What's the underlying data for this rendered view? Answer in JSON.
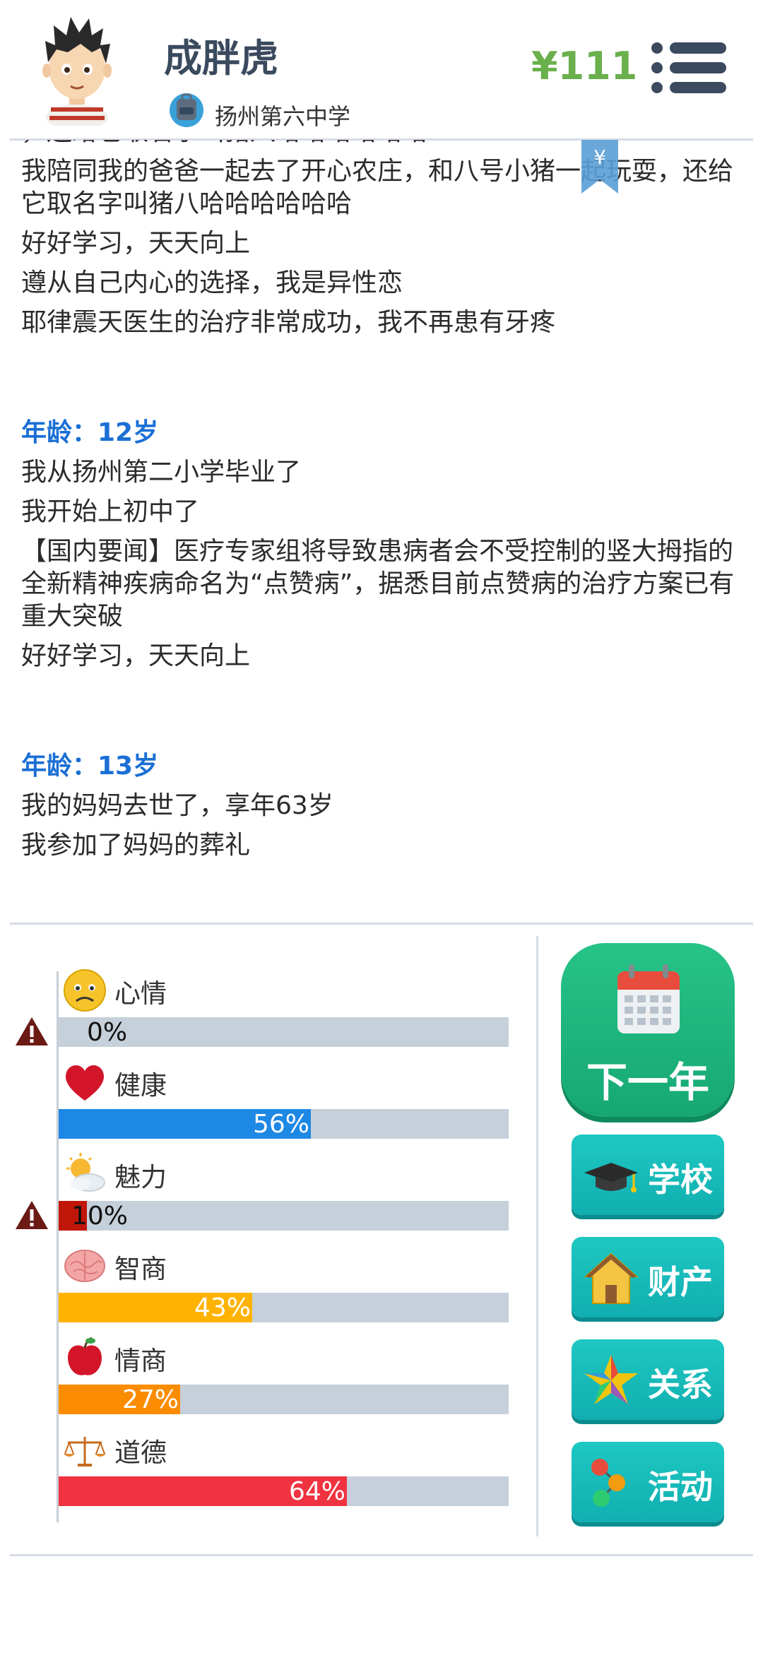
{
  "header": {
    "name": "成胖虎",
    "school": "扬州第六中学",
    "money": "¥111"
  },
  "bookmark": {
    "symbol": "¥"
  },
  "log": {
    "partial_line": "，还给它取名字叫猪八哈哈哈哈哈哈",
    "year11": [
      "我陪同我的爸爸一起去了开心农庄，和八号小猪一起玩耍，还给它取名字叫猪八哈哈哈哈哈哈",
      "好好学习，天天向上",
      "遵从自己内心的选择，我是异性恋",
      "耶律震天医生的治疗非常成功，我不再患有牙疼"
    ],
    "age12": "年龄：12岁",
    "year12": [
      "我从扬州第二小学毕业了",
      "我开始上初中了",
      "【国内要闻】医疗专家组将导致患病者会不受控制的竖大拇指的全新精神疾病命名为“点赞病”，据悉目前点赞病的治疗方案已有重大突破",
      "好好学习，天天向上"
    ],
    "age13": "年龄：13岁",
    "year13": [
      "我的妈妈去世了，享年63岁",
      "我参加了妈妈的葬礼"
    ]
  },
  "stats": [
    {
      "label": "心情",
      "value": "0%",
      "percent": 0,
      "color": "#9e9e9e",
      "icon": "sad-face-icon",
      "warning": true
    },
    {
      "label": "健康",
      "value": "56%",
      "percent": 56,
      "color": "#1e88e5",
      "icon": "heart-icon",
      "warning": false
    },
    {
      "label": "魅力",
      "value": "10%",
      "percent": 10,
      "color": "#c0170a",
      "icon": "sun-cloud-icon",
      "warning": true
    },
    {
      "label": "智商",
      "value": "43%",
      "percent": 43,
      "color": "#ffb300",
      "icon": "brain-icon",
      "warning": false
    },
    {
      "label": "情商",
      "value": "27%",
      "percent": 27,
      "color": "#fb8c00",
      "icon": "apple-icon",
      "warning": false
    },
    {
      "label": "道德",
      "value": "64%",
      "percent": 64,
      "color": "#ef3340",
      "icon": "scales-icon",
      "warning": false
    }
  ],
  "buttons": {
    "next_year": "下一年",
    "school": "学校",
    "property": "财产",
    "relations": "关系",
    "activities": "活动"
  }
}
